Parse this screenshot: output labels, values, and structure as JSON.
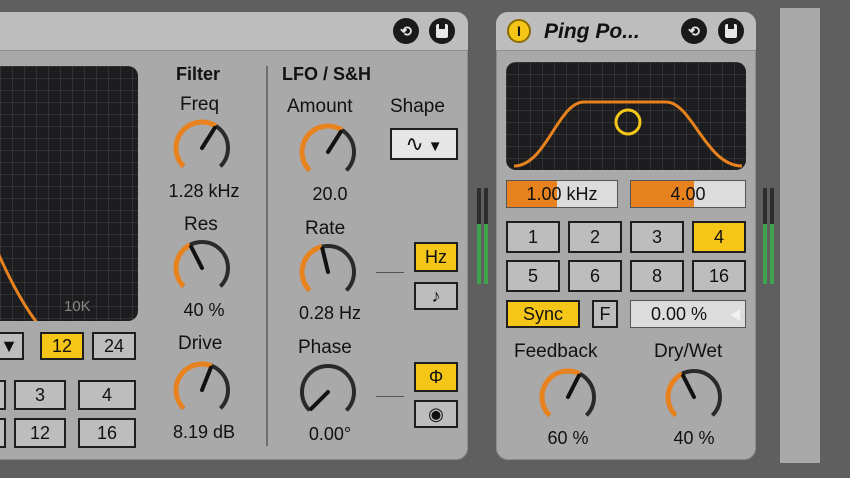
{
  "filter_device": {
    "filter": {
      "heading": "Filter",
      "freq": {
        "label": "Freq",
        "value": "1.28 kHz",
        "level": 0.62
      },
      "res": {
        "label": "Res",
        "value": "40 %",
        "level": 0.4
      },
      "drive": {
        "label": "Drive",
        "value": "8.19 dB",
        "level": 0.58
      },
      "display_label": "10K",
      "slope_dropdown": "▼",
      "slope_12": "12",
      "slope_24": "24",
      "beat_buttons": [
        "3",
        "4",
        "12",
        "16"
      ]
    },
    "lfo": {
      "heading": "LFO / S&H",
      "amount": {
        "label": "Amount",
        "value": "20.0",
        "level": 0.62
      },
      "shape": {
        "label": "Shape",
        "selected": "∿",
        "arrow": "▼"
      },
      "rate": {
        "label": "Rate",
        "value": "0.28 Hz",
        "level": 0.45
      },
      "phase": {
        "label": "Phase",
        "value": "0.00°",
        "level": 0.0
      },
      "hz_button": "Hz",
      "note_button": "♪",
      "phi_button": "Φ",
      "spin_button": "◉"
    }
  },
  "ping_pong": {
    "title": "Ping Po...",
    "power_icon": "I",
    "freq_field": "1.00 kHz",
    "freq_level": 0.45,
    "width_field": "4.00",
    "width_level": 0.55,
    "beat_buttons": [
      "1",
      "2",
      "3",
      "4",
      "5",
      "6",
      "8",
      "16"
    ],
    "selected_beat": "4",
    "sync_button": "Sync",
    "f_button": "F",
    "offset_field": "0.00 %",
    "feedback": {
      "label": "Feedback",
      "value": "60 %",
      "level": 0.6
    },
    "drywet": {
      "label": "Dry/Wet",
      "value": "40 %",
      "level": 0.4
    }
  },
  "colors": {
    "accent_orange": "#e8821e",
    "selected_yellow": "#f5c518",
    "meter_green": "#3fa34d"
  }
}
